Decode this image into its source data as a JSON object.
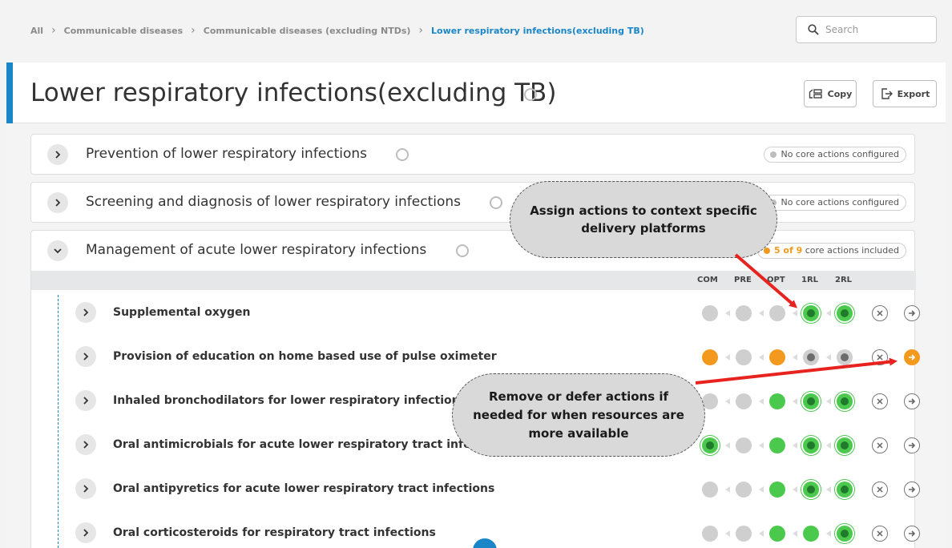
{
  "breadcrumb": [
    "All",
    "Communicable diseases",
    "Communicable diseases (excluding NTDs)",
    "Lower respiratory infections(excluding TB)"
  ],
  "search": {
    "placeholder": "Search"
  },
  "page": {
    "title": "Lower respiratory infections(excluding TB)"
  },
  "toolbar": {
    "copy_label": "Copy",
    "export_label": "Export"
  },
  "sections": [
    {
      "label": "Prevention of lower respiratory infections",
      "badge": "No core actions configured"
    },
    {
      "label": "Screening and diagnosis of lower respiratory infections",
      "badge": "No core actions configured"
    },
    {
      "label": "Management of acute lower respiratory infections",
      "badge_count": "5 of 9",
      "badge_suffix": "core actions included"
    }
  ],
  "platform_columns": [
    "COM",
    "PRE",
    "OPT",
    "1RL",
    "2RL"
  ],
  "actions": [
    {
      "label": "Supplemental oxygen",
      "platforms": [
        "gray",
        "gray",
        "gray",
        "green-selected",
        "green-selected"
      ]
    },
    {
      "label": "Provision of education on home based use of pulse oximeter",
      "platforms": [
        "orange",
        "gray",
        "orange",
        "gray-selected",
        "gray-selected"
      ]
    },
    {
      "label": "Inhaled bronchodilators for lower respiratory infections",
      "platforms": [
        "gray",
        "gray",
        "green",
        "green-selected",
        "green-selected"
      ]
    },
    {
      "label": "Oral antimicrobials for acute lower respiratory tract infections",
      "platforms": [
        "green-selected",
        "gray",
        "green",
        "green-selected",
        "green-selected"
      ]
    },
    {
      "label": "Oral antipyretics for acute lower respiratory tract infections",
      "platforms": [
        "gray",
        "gray",
        "green",
        "green-selected",
        "green-selected"
      ]
    },
    {
      "label": "Oral corticosteroids for respiratory tract infections",
      "platforms": [
        "gray",
        "gray",
        "green",
        "green",
        "green-selected"
      ]
    }
  ],
  "callouts": {
    "assign": "Assign actions to context specific delivery platforms",
    "remove": "Remove or defer actions if needed for when resources are more available"
  },
  "colors": {
    "accent": "#1a86c8",
    "included": "#4ac94d",
    "deferred": "#f39a1e",
    "arrow": "#e8231f"
  }
}
